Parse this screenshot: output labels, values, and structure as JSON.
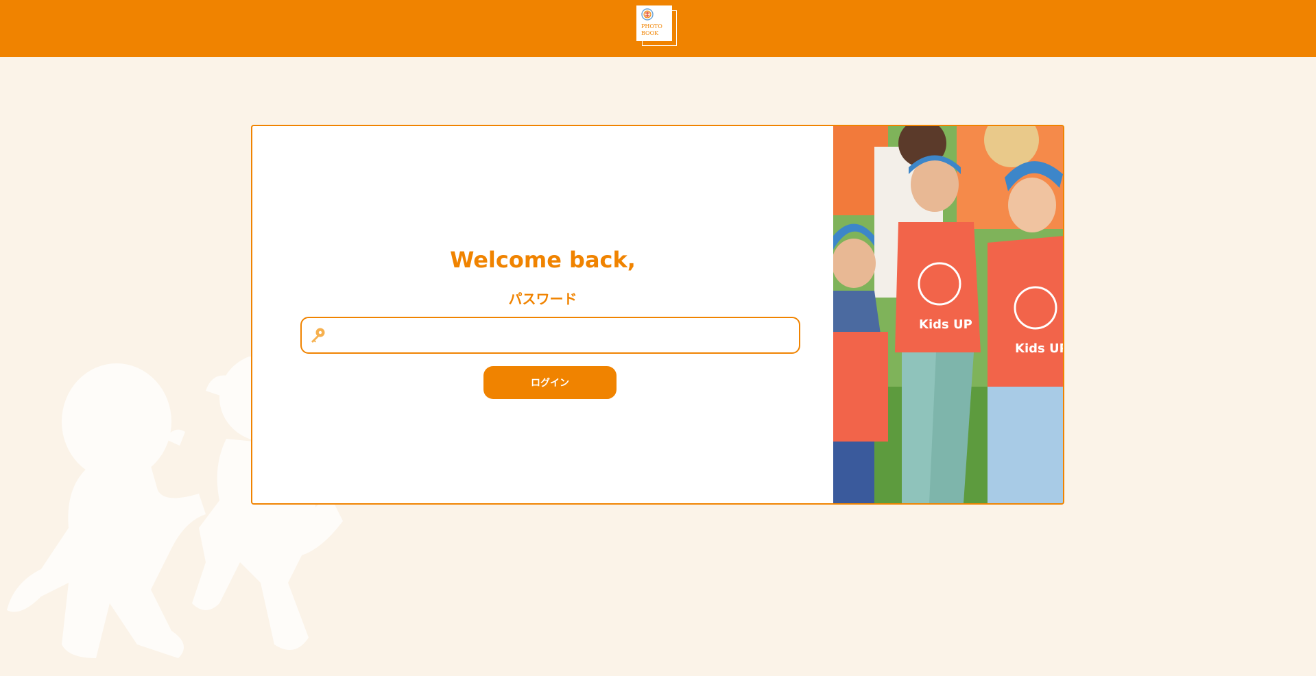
{
  "header": {
    "logo_text_line1": "PHOTO",
    "logo_text_line2": "BOOK",
    "bg_color": "#f08300"
  },
  "login": {
    "title": "Welcome back,",
    "password_label": "パスワード",
    "password_value": "",
    "login_button": "ログイン"
  },
  "photo": {
    "vest_text_1": "Kids UP",
    "vest_text_2": "Kids UP"
  },
  "colors": {
    "accent": "#f08300",
    "page_bg": "#fbf3e8"
  }
}
